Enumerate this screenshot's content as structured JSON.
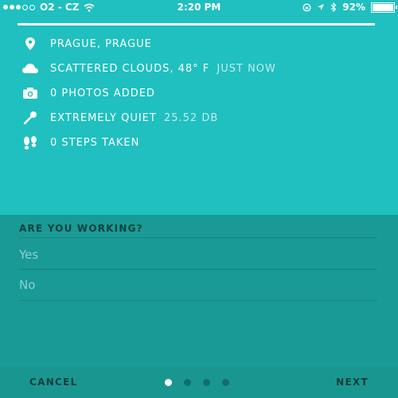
{
  "status_bar": {
    "carrier": "O2 - CZ",
    "time": "2:20 PM",
    "battery": "92%",
    "battery_level": 0.92,
    "signal_bars": 3,
    "signal_total": 5
  },
  "info": {
    "location": "PRAGUE, PRAGUE",
    "weather": "SCATTERED CLOUDS, 48° F",
    "weather_time": "JUST NOW",
    "photos": "0 PHOTOS ADDED",
    "noise": "EXTREMELY QUIET",
    "noise_level": "25.52 DB",
    "steps": "0 STEPS TAKEN"
  },
  "question": {
    "title": "ARE YOU WORKING?",
    "options": [
      "Yes",
      "No"
    ]
  },
  "footer": {
    "cancel": "CANCEL",
    "next": "NEXT",
    "page_count": 4,
    "active_page": 1
  },
  "colors": {
    "background": "#1fc0bf",
    "panel": "#199a96",
    "footer": "#1a9691",
    "dark_text": "#0f3f3c"
  }
}
